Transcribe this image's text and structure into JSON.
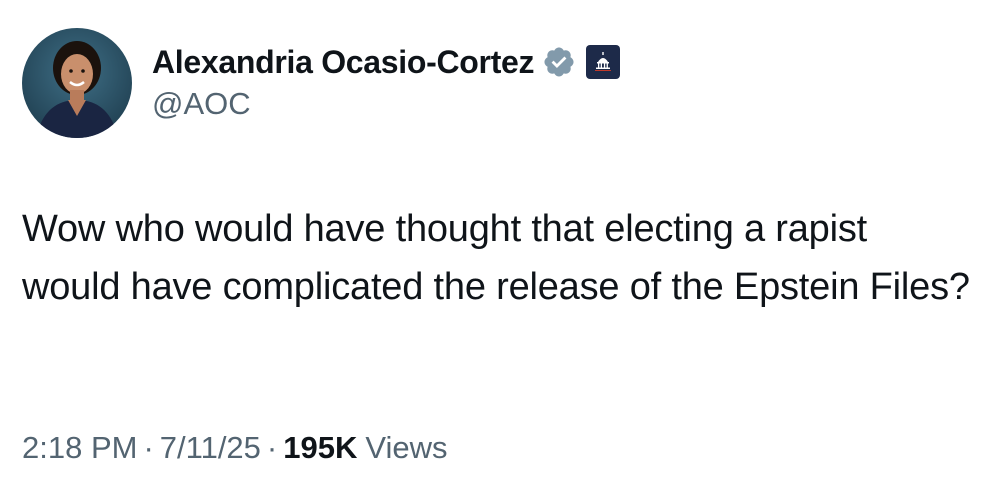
{
  "author": {
    "display_name": "Alexandria Ocasio-Cortez",
    "handle": "@AOC",
    "verified_icon": "verified-badge-icon",
    "affiliate_icon": "capitol-dome-icon",
    "badge_color": "#829aab"
  },
  "tweet": {
    "text": "Wow who would have thought that electing a rapist would have complicated the release of the Epstein Files?"
  },
  "meta": {
    "time": "2:18 PM",
    "separator": "·",
    "date": "7/11/25",
    "views_count": "195K",
    "views_label": "Views"
  }
}
